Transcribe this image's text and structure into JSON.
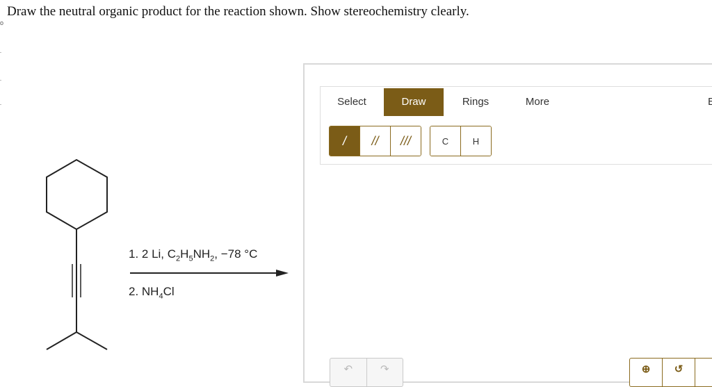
{
  "question": {
    "text": "Draw the neutral organic product for the reaction shown. Show stereochemistry clearly."
  },
  "edge_mark": "o",
  "reaction": {
    "step1": {
      "prefix": "1. 2 Li, C",
      "sub1": "2",
      "mid1": "H",
      "sub2": "5",
      "mid2": "NH",
      "sub3": "2",
      "suffix": ", −78 °C"
    },
    "step2": {
      "prefix": "2. NH",
      "sub1": "4",
      "suffix": "Cl"
    }
  },
  "editor": {
    "tabs": [
      {
        "label": "Select",
        "active": false
      },
      {
        "label": "Draw",
        "active": true
      },
      {
        "label": "Rings",
        "active": false
      },
      {
        "label": "More",
        "active": false
      },
      {
        "label": "E",
        "active": false
      }
    ],
    "bond_buttons": [
      {
        "label": "/",
        "selected": true
      },
      {
        "label": "//",
        "selected": false
      },
      {
        "label": "///",
        "selected": false
      }
    ],
    "atom_buttons": [
      "C",
      "H"
    ],
    "icons": {
      "undo": "undo-arrow-icon",
      "redo": "redo-arrow-icon",
      "zoom_in": "zoom-in-icon",
      "reset": "reset-rotate-icon"
    }
  },
  "colors": {
    "accent": "#7b5c17",
    "accent_border": "#8a6a1e",
    "panel_border": "#d8d8d8"
  }
}
